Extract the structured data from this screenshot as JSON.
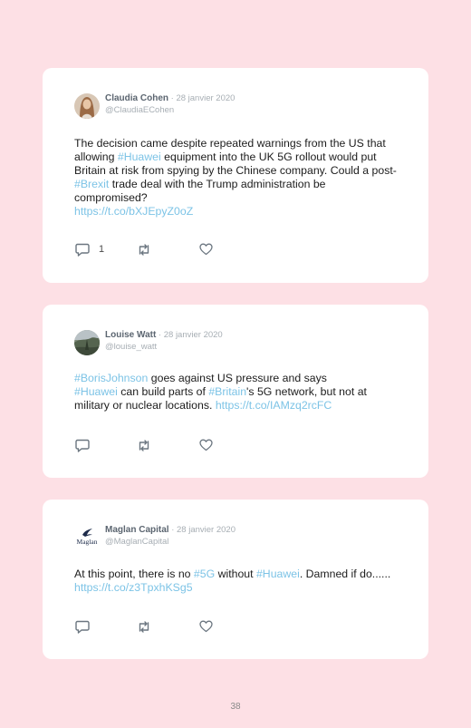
{
  "tweets": [
    {
      "name": "Claudia Cohen",
      "date": " · 28 janvier 2020",
      "handle": "@ClaudiaECohen",
      "text": [
        "The decision came despite repeated warnings from the US that allowing ",
        "#Huawei",
        " equipment into the UK 5G rollout would put Britain at risk from spying by the Chinese company. Could a post-",
        "#Brexit",
        " trade deal with the Trump administration be compromised?",
        "https://t.co/bXJEpyZ0oZ"
      ],
      "reply_count": "1",
      "avatar_icon": "woman-portrait"
    },
    {
      "name": "Louise Watt",
      "date": " · 28 janvier 2020",
      "handle": "@louise_watt",
      "text": [
        "#BorisJohnson",
        " goes against US pressure and says ",
        "#Huawei",
        " can build parts of ",
        "#Britain",
        "'s 5G network, but not at military or nuclear locations. ",
        "https://t.co/IAMzq2rcFC"
      ],
      "reply_count": "",
      "avatar_icon": "landscape-photo"
    },
    {
      "name": "Maglan Capital",
      "date": " · 28 janvier 2020",
      "handle": "@MaglanCapital",
      "text": [
        "At this point, there is no ",
        "#5G",
        " without ",
        "#Huawei",
        ". Damned if do...... ",
        "https://t.co/z3TpxhKSg5"
      ],
      "reply_count": "",
      "avatar_icon": "maglan-logo",
      "avatar_logo_text": "Maglan"
    }
  ],
  "page_number": "38",
  "colors": {
    "background": "#fde0e5",
    "card": "#ffffff",
    "link": "#7cc3e6",
    "name": "#5b6570",
    "muted": "#a7aeb4",
    "icon": "#6b7680"
  },
  "icons": [
    "reply-icon",
    "retweet-icon",
    "like-icon"
  ]
}
